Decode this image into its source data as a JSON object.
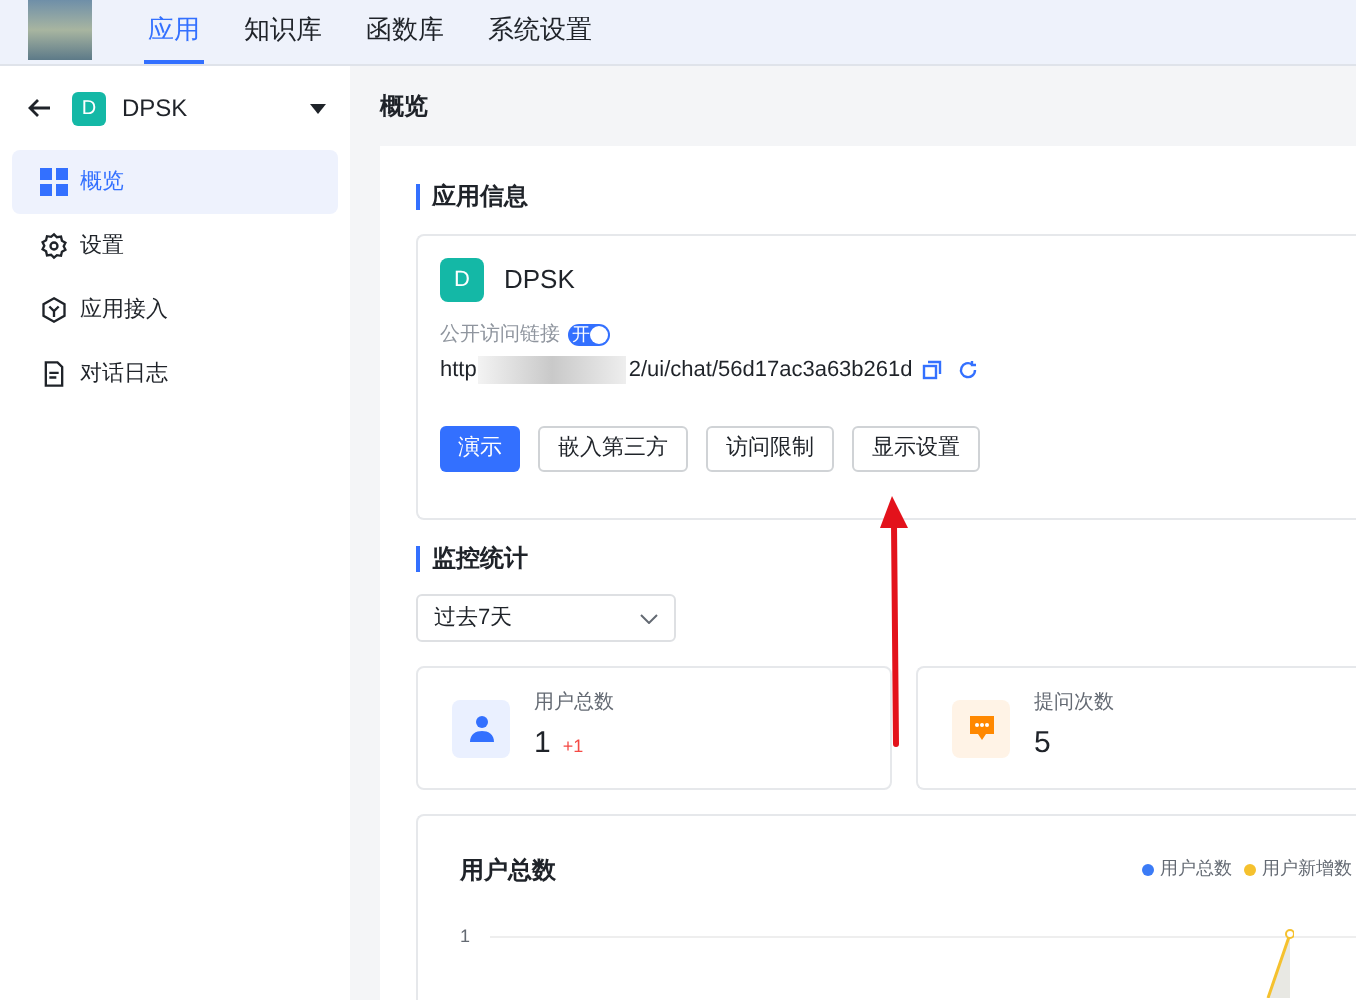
{
  "top_nav": {
    "tabs": [
      {
        "label": "应用",
        "selected": true
      },
      {
        "label": "知识库",
        "selected": false
      },
      {
        "label": "函数库",
        "selected": false
      },
      {
        "label": "系统设置",
        "selected": false
      }
    ]
  },
  "sidebar": {
    "app_avatar": "D",
    "app_name": "DPSK",
    "items": [
      {
        "label": "概览",
        "kind": "grid",
        "selected": true
      },
      {
        "label": "设置",
        "kind": "gear",
        "selected": false
      },
      {
        "label": "应用接入",
        "kind": "hexagon",
        "selected": false
      },
      {
        "label": "对话日志",
        "kind": "document",
        "selected": false
      }
    ]
  },
  "page_title": "概览",
  "app_info": {
    "heading": "应用信息",
    "avatar": "D",
    "name": "DPSK",
    "public_link_label": "公开访问链接",
    "public_link_on": true,
    "toggle_text": "开",
    "url_start": "http",
    "url_end": "2/ui/chat/56d17ac3a63b261d",
    "buttons": [
      {
        "label": "演示",
        "primary": true
      },
      {
        "label": "嵌入第三方",
        "primary": false
      },
      {
        "label": "访问限制",
        "primary": false
      },
      {
        "label": "显示设置",
        "primary": false
      }
    ]
  },
  "monitor": {
    "heading": "监控统计",
    "period": "过去7天",
    "stats": [
      {
        "kind": "user",
        "label": "用户总数",
        "value": "1",
        "delta": "+1"
      },
      {
        "kind": "chat",
        "label": "提问次数",
        "value": "5"
      }
    ],
    "chart": {
      "title": "用户总数",
      "legend": [
        {
          "label": "用户总数",
          "color": "#3b7bf6"
        },
        {
          "label": "用户新增数",
          "color": "#f5c12e"
        }
      ],
      "tick_label": "1"
    }
  }
}
